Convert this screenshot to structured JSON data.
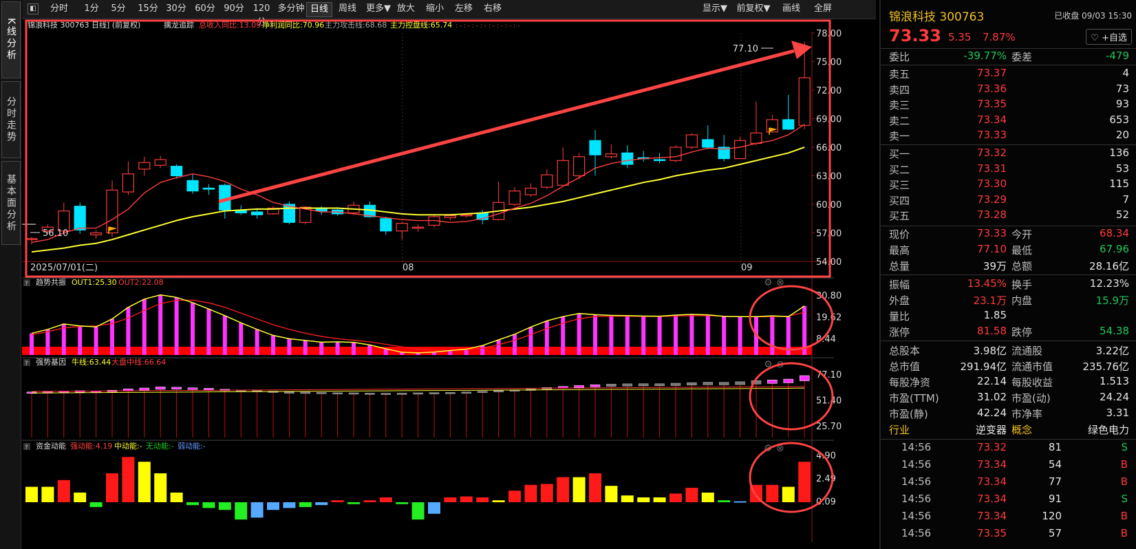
{
  "sidebar_tabs": [
    "K线分析",
    "分时走势",
    "基本面分析"
  ],
  "toolbar": {
    "items": [
      "分时",
      "1分",
      "5分",
      "15分",
      "30分",
      "60分",
      "90分",
      "120分",
      "多分钟",
      "日线",
      "周线",
      "更多▼",
      "放大",
      "缩小",
      "左移",
      "右移"
    ],
    "active": "日线",
    "right": [
      "显示▼",
      "前复权▼",
      "画线",
      "全屏"
    ]
  },
  "main_chart": {
    "header": {
      "title": "锦浪科技 300763 日线] (前复权)",
      "ind_name": "擒龙追踪",
      "ind1": "总收入同比:13.09",
      "ind2": "净利润同比:70.96",
      "ind3": "主力攻击线:68.68",
      "ind4": "主力控盘线:65.74"
    },
    "price_axis": [
      "78.00",
      "75.00",
      "72.00",
      "69.00",
      "66.00",
      "63.00",
      "60.00",
      "57.00",
      "54.00"
    ],
    "high_label": "77.10",
    "low_label": "56.10",
    "date_labels": [
      "2025/07/01(二)",
      "08",
      "09"
    ]
  },
  "panel1": {
    "name": "趋势共振",
    "out1": "OUT1:25.30",
    "out2": "OUT2:22.08",
    "axis": [
      "30.80",
      "19.62",
      "8.44"
    ]
  },
  "panel2": {
    "name": "强势基因",
    "l1": "牛线:63.44",
    "l2": "大盘中线:66.64",
    "axis": [
      "77.10",
      "51.40",
      "25.70"
    ]
  },
  "panel3": {
    "name": "资金动能",
    "l1": "强动能:4.19",
    "l2": "中动能:-",
    "l3": "无动能:-",
    "l4": "弱动能:-",
    "axis": [
      "4.90",
      "2.49",
      "0.09"
    ]
  },
  "colors": {
    "up": "#ff3b3b",
    "down": "#00e5ff",
    "ma1": "#ffff33",
    "ma2": "#ff4040",
    "frame": "#ff4444",
    "magenta": "#ff33ff"
  },
  "quote": {
    "name": "锦浪科技",
    "code": "300763",
    "status": "已收盘 09/03 15:30",
    "price": "73.33",
    "change": "5.35",
    "pct": "7.87%",
    "fav": "+自选",
    "webi_label": "委比",
    "webi": "-39.77%",
    "weicha_label": "委差",
    "weicha": "-479",
    "sells": [
      {
        "l": "卖五",
        "p": "73.37",
        "v": "4"
      },
      {
        "l": "卖四",
        "p": "73.36",
        "v": "73"
      },
      {
        "l": "卖三",
        "p": "73.35",
        "v": "93"
      },
      {
        "l": "卖二",
        "p": "73.34",
        "v": "653"
      },
      {
        "l": "卖一",
        "p": "73.33",
        "v": "20"
      }
    ],
    "buys": [
      {
        "l": "买一",
        "p": "73.32",
        "v": "136"
      },
      {
        "l": "买二",
        "p": "73.31",
        "v": "53"
      },
      {
        "l": "买三",
        "p": "73.30",
        "v": "115"
      },
      {
        "l": "买四",
        "p": "73.29",
        "v": "7"
      },
      {
        "l": "买五",
        "p": "73.28",
        "v": "52"
      }
    ],
    "stats": [
      [
        {
          "l": "现价",
          "v": "73.33",
          "c": "r"
        },
        {
          "l": "今开",
          "v": "68.34",
          "c": "r"
        }
      ],
      [
        {
          "l": "最高",
          "v": "77.10",
          "c": "r"
        },
        {
          "l": "最低",
          "v": "67.96",
          "c": "g"
        }
      ],
      [
        {
          "l": "总量",
          "v": "39万",
          "c": "w"
        },
        {
          "l": "总额",
          "v": "28.16亿",
          "c": "w"
        }
      ],
      [
        {
          "l": "振幅",
          "v": "13.45%",
          "c": "r"
        },
        {
          "l": "换手",
          "v": "12.23%",
          "c": "w"
        }
      ],
      [
        {
          "l": "外盘",
          "v": "23.1万",
          "c": "r"
        },
        {
          "l": "内盘",
          "v": "15.9万",
          "c": "g"
        }
      ],
      [
        {
          "l": "量比",
          "v": "1.85",
          "c": "w"
        },
        {
          "l": "",
          "v": "",
          "c": "w"
        }
      ],
      [
        {
          "l": "涨停",
          "v": "81.58",
          "c": "r"
        },
        {
          "l": "跌停",
          "v": "54.38",
          "c": "g"
        }
      ],
      [
        {
          "l": "总股本",
          "v": "3.98亿",
          "c": "w"
        },
        {
          "l": "流通股",
          "v": "3.22亿",
          "c": "w"
        }
      ],
      [
        {
          "l": "总市值",
          "v": "291.94亿",
          "c": "w"
        },
        {
          "l": "流通市值",
          "v": "235.76亿",
          "c": "w"
        }
      ],
      [
        {
          "l": "每股净资",
          "v": "22.14",
          "c": "w"
        },
        {
          "l": "每股收益",
          "v": "1.513",
          "c": "w"
        }
      ],
      [
        {
          "l": "市盈(TTM)",
          "v": "31.02",
          "c": "w"
        },
        {
          "l": "市盈(动)",
          "v": "24.24",
          "c": "w"
        }
      ],
      [
        {
          "l": "市盈(静)",
          "v": "42.24",
          "c": "w"
        },
        {
          "l": "市净率",
          "v": "3.31",
          "c": "w"
        }
      ]
    ],
    "industry_label": "行业",
    "industry": "逆变器",
    "concept_label": "概念",
    "concept": "绿色电力",
    "ticks": [
      {
        "t": "14:56",
        "p": "73.32",
        "v": "81",
        "s": "S"
      },
      {
        "t": "14:56",
        "p": "73.34",
        "v": "54",
        "s": "B"
      },
      {
        "t": "14:56",
        "p": "73.34",
        "v": "77",
        "s": "B"
      },
      {
        "t": "14:56",
        "p": "73.34",
        "v": "91",
        "s": "S"
      },
      {
        "t": "14:56",
        "p": "73.34",
        "v": "120",
        "s": "B"
      },
      {
        "t": "14:56",
        "p": "73.35",
        "v": "57",
        "s": "B"
      }
    ]
  },
  "chart_data": {
    "type": "candlestick",
    "price_range": [
      54,
      78
    ],
    "candles": [
      {
        "o": 56.4,
        "c": 56.4,
        "h": 56.6,
        "l": 55.8
      },
      {
        "o": 57.2,
        "c": 57.6,
        "h": 57.9,
        "l": 56.9
      },
      {
        "o": 57.2,
        "c": 59.3,
        "h": 60.2,
        "l": 57.0
      },
      {
        "o": 59.8,
        "c": 57.3,
        "h": 60.2,
        "l": 56.9
      },
      {
        "o": 56.8,
        "c": 57.0,
        "h": 57.3,
        "l": 56.4
      },
      {
        "o": 57.0,
        "c": 61.5,
        "h": 62.5,
        "l": 56.6
      },
      {
        "o": 61.3,
        "c": 63.2,
        "h": 64.5,
        "l": 61.0
      },
      {
        "o": 63.7,
        "c": 64.4,
        "h": 65.0,
        "l": 63.0
      },
      {
        "o": 64.1,
        "c": 64.7,
        "h": 65.1,
        "l": 63.8
      },
      {
        "o": 64.0,
        "c": 63.0,
        "h": 64.2,
        "l": 62.7
      },
      {
        "o": 62.5,
        "c": 61.4,
        "h": 63.2,
        "l": 61.1
      },
      {
        "o": 61.7,
        "c": 61.6,
        "h": 62.1,
        "l": 61.0
      },
      {
        "o": 62.0,
        "c": 59.4,
        "h": 62.2,
        "l": 58.5
      },
      {
        "o": 59.4,
        "c": 59.1,
        "h": 59.9,
        "l": 58.9
      },
      {
        "o": 59.2,
        "c": 58.9,
        "h": 59.6,
        "l": 58.5
      },
      {
        "o": 59.0,
        "c": 59.6,
        "h": 59.8,
        "l": 58.9
      },
      {
        "o": 60.0,
        "c": 58.1,
        "h": 60.3,
        "l": 57.9
      },
      {
        "o": 58.1,
        "c": 59.7,
        "h": 59.8,
        "l": 57.9
      },
      {
        "o": 59.6,
        "c": 59.3,
        "h": 59.8,
        "l": 58.9
      },
      {
        "o": 59.4,
        "c": 59.0,
        "h": 59.7,
        "l": 58.8
      },
      {
        "o": 59.1,
        "c": 59.9,
        "h": 60.3,
        "l": 58.9
      },
      {
        "o": 59.9,
        "c": 58.7,
        "h": 60.3,
        "l": 58.6
      },
      {
        "o": 58.5,
        "c": 57.2,
        "h": 58.7,
        "l": 56.8
      },
      {
        "o": 57.2,
        "c": 58.0,
        "h": 58.2,
        "l": 56.3
      },
      {
        "o": 57.5,
        "c": 57.6,
        "h": 57.9,
        "l": 57.1
      },
      {
        "o": 57.8,
        "c": 58.7,
        "h": 58.9,
        "l": 57.6
      },
      {
        "o": 58.6,
        "c": 58.8,
        "h": 59.0,
        "l": 58.3
      },
      {
        "o": 58.9,
        "c": 58.9,
        "h": 59.1,
        "l": 58.6
      },
      {
        "o": 59.1,
        "c": 58.4,
        "h": 59.4,
        "l": 57.9
      },
      {
        "o": 58.4,
        "c": 60.2,
        "h": 62.4,
        "l": 58.3
      },
      {
        "o": 60.0,
        "c": 61.4,
        "h": 61.8,
        "l": 59.8
      },
      {
        "o": 61.0,
        "c": 61.7,
        "h": 62.2,
        "l": 60.8
      },
      {
        "o": 61.8,
        "c": 63.1,
        "h": 63.7,
        "l": 61.6
      },
      {
        "o": 62.0,
        "c": 64.6,
        "h": 66.0,
        "l": 61.9
      },
      {
        "o": 63.0,
        "c": 65.0,
        "h": 65.4,
        "l": 62.6
      },
      {
        "o": 66.7,
        "c": 65.2,
        "h": 67.8,
        "l": 63.0
      },
      {
        "o": 65.0,
        "c": 65.3,
        "h": 66.3,
        "l": 64.8
      },
      {
        "o": 65.4,
        "c": 64.2,
        "h": 66.2,
        "l": 63.8
      },
      {
        "o": 64.9,
        "c": 64.8,
        "h": 65.6,
        "l": 64.5
      },
      {
        "o": 64.7,
        "c": 64.6,
        "h": 65.4,
        "l": 64.3
      },
      {
        "o": 64.6,
        "c": 66.0,
        "h": 66.2,
        "l": 64.4
      },
      {
        "o": 66.0,
        "c": 67.3,
        "h": 67.5,
        "l": 65.8
      },
      {
        "o": 66.8,
        "c": 66.0,
        "h": 68.3,
        "l": 65.8
      },
      {
        "o": 66.0,
        "c": 64.8,
        "h": 67.3,
        "l": 64.5
      },
      {
        "o": 64.8,
        "c": 66.7,
        "h": 67.1,
        "l": 64.8
      },
      {
        "o": 66.4,
        "c": 67.5,
        "h": 70.8,
        "l": 66.2
      },
      {
        "o": 67.6,
        "c": 68.9,
        "h": 69.4,
        "l": 67.6
      },
      {
        "o": 68.9,
        "c": 67.9,
        "h": 71.5,
        "l": 67.8
      },
      {
        "o": 68.3,
        "c": 73.3,
        "h": 77.1,
        "l": 67.9
      }
    ],
    "ma5": [
      56.0,
      56.3,
      57.0,
      57.5,
      57.5,
      58.4,
      59.5,
      61.2,
      62.3,
      62.8,
      63.2,
      62.9,
      62.4,
      61.6,
      61.0,
      60.2,
      59.8,
      59.5,
      59.2,
      59.2,
      59.0,
      58.8,
      58.6,
      58.4,
      58.3,
      58.3,
      58.1,
      58.2,
      58.5,
      59.0,
      59.6,
      60.1,
      60.9,
      61.9,
      62.8,
      63.8,
      64.3,
      64.6,
      64.8,
      64.9,
      65.0,
      65.5,
      65.9,
      65.8,
      66.0,
      66.4,
      66.7,
      67.3,
      68.4
    ],
    "ma20": [
      55.0,
      55.2,
      55.4,
      55.7,
      55.9,
      56.3,
      56.8,
      57.3,
      57.8,
      58.3,
      58.7,
      59.0,
      59.3,
      59.4,
      59.5,
      59.5,
      59.6,
      59.6,
      59.6,
      59.6,
      59.5,
      59.4,
      59.2,
      59.0,
      58.9,
      58.9,
      58.9,
      59.0,
      59.1,
      59.3,
      59.5,
      59.7,
      60.0,
      60.3,
      60.7,
      61.1,
      61.5,
      61.9,
      62.3,
      62.6,
      63.0,
      63.3,
      63.6,
      63.8,
      64.2,
      64.6,
      65.0,
      65.4,
      66.0
    ],
    "panel1_out1": [
      11.2,
      13.2,
      16.0,
      15.0,
      14.5,
      18.6,
      24.6,
      28.8,
      31.0,
      29.7,
      27.0,
      23.7,
      20.3,
      16.6,
      13.2,
      10.1,
      8.4,
      7.5,
      6.6,
      6.8,
      6.5,
      5.2,
      3.2,
      1.4,
      1.1,
      1.5,
      2.3,
      3.0,
      4.9,
      7.8,
      10.7,
      14.4,
      17.6,
      19.8,
      21.4,
      20.8,
      20.4,
      20.3,
      20.1,
      20.0,
      20.6,
      21.0,
      20.7,
      19.9,
      19.8,
      19.8,
      20.2,
      19.8,
      25.3
    ],
    "panel1_out2": [
      10.5,
      12.0,
      14.0,
      14.7,
      15.0,
      16.2,
      19.0,
      23.0,
      26.5,
      28.2,
      28.3,
      26.9,
      24.6,
      21.6,
      18.6,
      15.6,
      13.2,
      11.2,
      9.6,
      8.4,
      7.6,
      6.8,
      5.5,
      4.2,
      3.1,
      2.5,
      2.4,
      2.7,
      3.5,
      5.3,
      7.6,
      10.5,
      13.6,
      16.4,
      18.7,
      19.8,
      20.0,
      20.0,
      19.9,
      19.9,
      20.1,
      20.3,
      20.3,
      20.0,
      19.8,
      19.7,
      19.8,
      20.0,
      22.1
    ],
    "panel2_top": [
      59.5,
      59.8,
      60.4,
      60.8,
      60.3,
      61.3,
      62.7,
      63.5,
      64.6,
      64.3,
      63.7,
      63.2,
      62.2,
      61.5,
      61.0,
      60.4,
      59.6,
      59.4,
      59.1,
      58.8,
      58.7,
      58.4,
      58.3,
      58.4,
      58.7,
      58.9,
      59.1,
      59.5,
      60.3,
      60.9,
      61.7,
      62.6,
      64.1,
      65.1,
      66.0,
      66.8,
      67.4,
      67.7,
      67.8,
      67.8,
      68.3,
      68.9,
      69.3,
      69.2,
      69.8,
      70.9,
      71.6,
      72.4,
      75.9
    ],
    "panel2_bottom": [
      58.2,
      58.6,
      59.0,
      59.2,
      59.2,
      59.7,
      60.5,
      61.3,
      62.2,
      62.3,
      62.0,
      61.7,
      61.2,
      60.7,
      60.3,
      59.9,
      59.3,
      59.1,
      58.9,
      58.6,
      58.5,
      58.3,
      58.1,
      57.9,
      57.9,
      58.1,
      58.3,
      58.6,
      59.1,
      59.6,
      60.3,
      61.1,
      62.3,
      63.3,
      64.0,
      64.6,
      65.1,
      65.4,
      65.6,
      65.7,
      65.9,
      66.4,
      66.7,
      66.6,
      66.9,
      67.5,
      68.1,
      68.7,
      70.7
    ],
    "panel2_pink": [
      true,
      true,
      true,
      true,
      true,
      true,
      true,
      true,
      true,
      true,
      true,
      true,
      true,
      false,
      false,
      false,
      false,
      false,
      false,
      false,
      false,
      false,
      false,
      false,
      false,
      false,
      false,
      false,
      false,
      false,
      false,
      false,
      false,
      true,
      true,
      true,
      false,
      false,
      false,
      false,
      false,
      false,
      false,
      false,
      false,
      false,
      true,
      true,
      true
    ],
    "panel2_line1": [
      60.1,
      60.2,
      60.3,
      60.4,
      60.5,
      60.6,
      60.7,
      60.8,
      60.9,
      61.0,
      61.1,
      61.2,
      61.3,
      61.4,
      61.5,
      61.6,
      61.7,
      61.8,
      61.9,
      62.0,
      62.1,
      62.2,
      62.3,
      62.4,
      62.5,
      62.6,
      62.7,
      62.8,
      62.9,
      63.0,
      63.1,
      63.2,
      63.3,
      63.4,
      63.5,
      63.6,
      63.7,
      63.8,
      63.9,
      64.0,
      64.1,
      64.2,
      64.3,
      64.4,
      64.5,
      64.6,
      64.7,
      64.8,
      64.9
    ],
    "panel2_line2": [
      58.5,
      58.6,
      58.7,
      58.8,
      58.9,
      59.0,
      59.1,
      59.2,
      59.3,
      59.4,
      59.5,
      59.6,
      59.7,
      59.8,
      59.9,
      60.0,
      60.1,
      60.2,
      60.3,
      60.4,
      60.5,
      60.6,
      60.7,
      60.8,
      60.9,
      61.0,
      61.1,
      61.2,
      61.3,
      61.4,
      61.5,
      61.6,
      61.7,
      61.8,
      61.9,
      62.0,
      62.1,
      62.2,
      62.3,
      62.4,
      62.5,
      62.6,
      62.7,
      62.8,
      62.9,
      63.0,
      63.1,
      63.2,
      63.4
    ],
    "panel3_values": [
      1.6,
      1.6,
      2.3,
      1.0,
      -0.5,
      3.0,
      4.7,
      4.2,
      3.0,
      1.0,
      -0.3,
      -0.6,
      -0.8,
      -1.8,
      -1.6,
      -0.8,
      -0.6,
      -0.5,
      -0.3,
      0.2,
      -0.2,
      0.2,
      0.5,
      -0.2,
      -1.8,
      -1.2,
      0.5,
      0.6,
      0.5,
      0.2,
      1.2,
      1.8,
      1.9,
      2.6,
      2.6,
      3.0,
      1.7,
      0.7,
      0.5,
      0.5,
      0.9,
      1.5,
      1.0,
      0.2,
      0.1,
      1.8,
      1.8,
      1.6,
      4.2
    ],
    "panel3_colors": [
      "y",
      "y",
      "r",
      "y",
      "g",
      "r",
      "r",
      "y",
      "y",
      "y",
      "g",
      "g",
      "g",
      "g",
      "b",
      "b",
      "b",
      "g",
      "b",
      "r",
      "g",
      "r",
      "r",
      "g",
      "g",
      "b",
      "r",
      "r",
      "r",
      "y",
      "r",
      "r",
      "r",
      "r",
      "y",
      "r",
      "y",
      "y",
      "y",
      "y",
      "r",
      "r",
      "y",
      "g",
      "b",
      "r",
      "r",
      "y",
      "r"
    ]
  }
}
